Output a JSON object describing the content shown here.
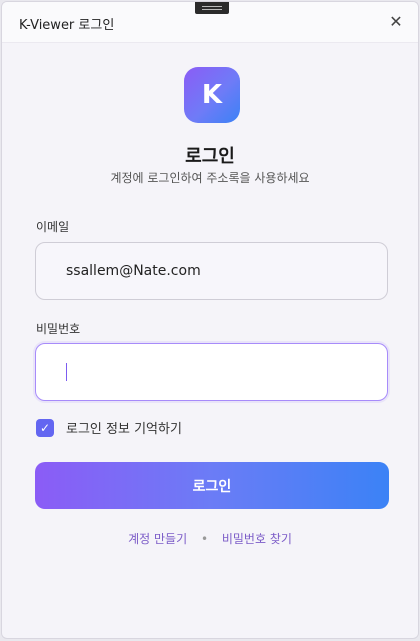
{
  "window": {
    "title": "K-Viewer 로그인"
  },
  "brand": {
    "logo_letter": "K"
  },
  "header": {
    "title": "로그인",
    "subtitle": "계정에 로그인하여 주소록을 사용하세요"
  },
  "form": {
    "email_label": "이메일",
    "email_value": "ssallem@Nate.com",
    "password_label": "비밀번호",
    "password_value": "",
    "remember_label": "로그인 정보 기억하기",
    "remember_checked": true,
    "submit_label": "로그인"
  },
  "footer": {
    "signup_link": "계정 만들기",
    "separator": "•",
    "forgot_link": "비밀번호 찾기"
  },
  "colors": {
    "accent_start": "#8b5cf6",
    "accent_end": "#3b82f6",
    "link": "#7c5cc8"
  }
}
